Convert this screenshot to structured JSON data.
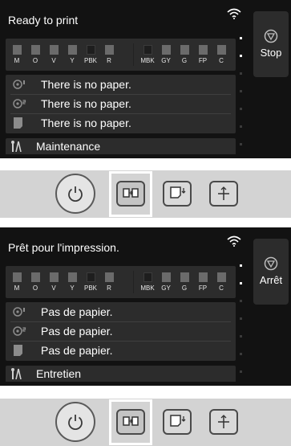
{
  "screens": [
    {
      "status_title": "Ready to print",
      "stop_label": "Stop",
      "inks_left": [
        "M",
        "O",
        "V",
        "Y",
        "PBK",
        "R"
      ],
      "inks_right": [
        "MBK",
        "GY",
        "G",
        "FP",
        "C"
      ],
      "messages": [
        {
          "icon": "paper-roll-1-icon",
          "text": "There is no paper."
        },
        {
          "icon": "paper-roll-2-icon",
          "text": "There is no paper."
        },
        {
          "icon": "cut-sheet-icon",
          "text": "There is no paper."
        }
      ],
      "maintenance_label": "Maintenance"
    },
    {
      "status_title": "Prêt pour l'impression.",
      "stop_label": "Arrêt",
      "inks_left": [
        "M",
        "O",
        "V",
        "Y",
        "PBK",
        "R"
      ],
      "inks_right": [
        "MBK",
        "GY",
        "G",
        "FP",
        "C"
      ],
      "messages": [
        {
          "icon": "paper-roll-1-icon",
          "text": "Pas de papier."
        },
        {
          "icon": "paper-roll-2-icon",
          "text": "Pas de papier."
        },
        {
          "icon": "cut-sheet-icon",
          "text": "Pas de papier."
        }
      ],
      "maintenance_label": "Entretien"
    }
  ],
  "control_panel": {
    "buttons": [
      "power-icon",
      "paper-settings-icon",
      "load-paper-icon",
      "cut-paper-icon"
    ],
    "highlighted": "paper-settings-button"
  }
}
